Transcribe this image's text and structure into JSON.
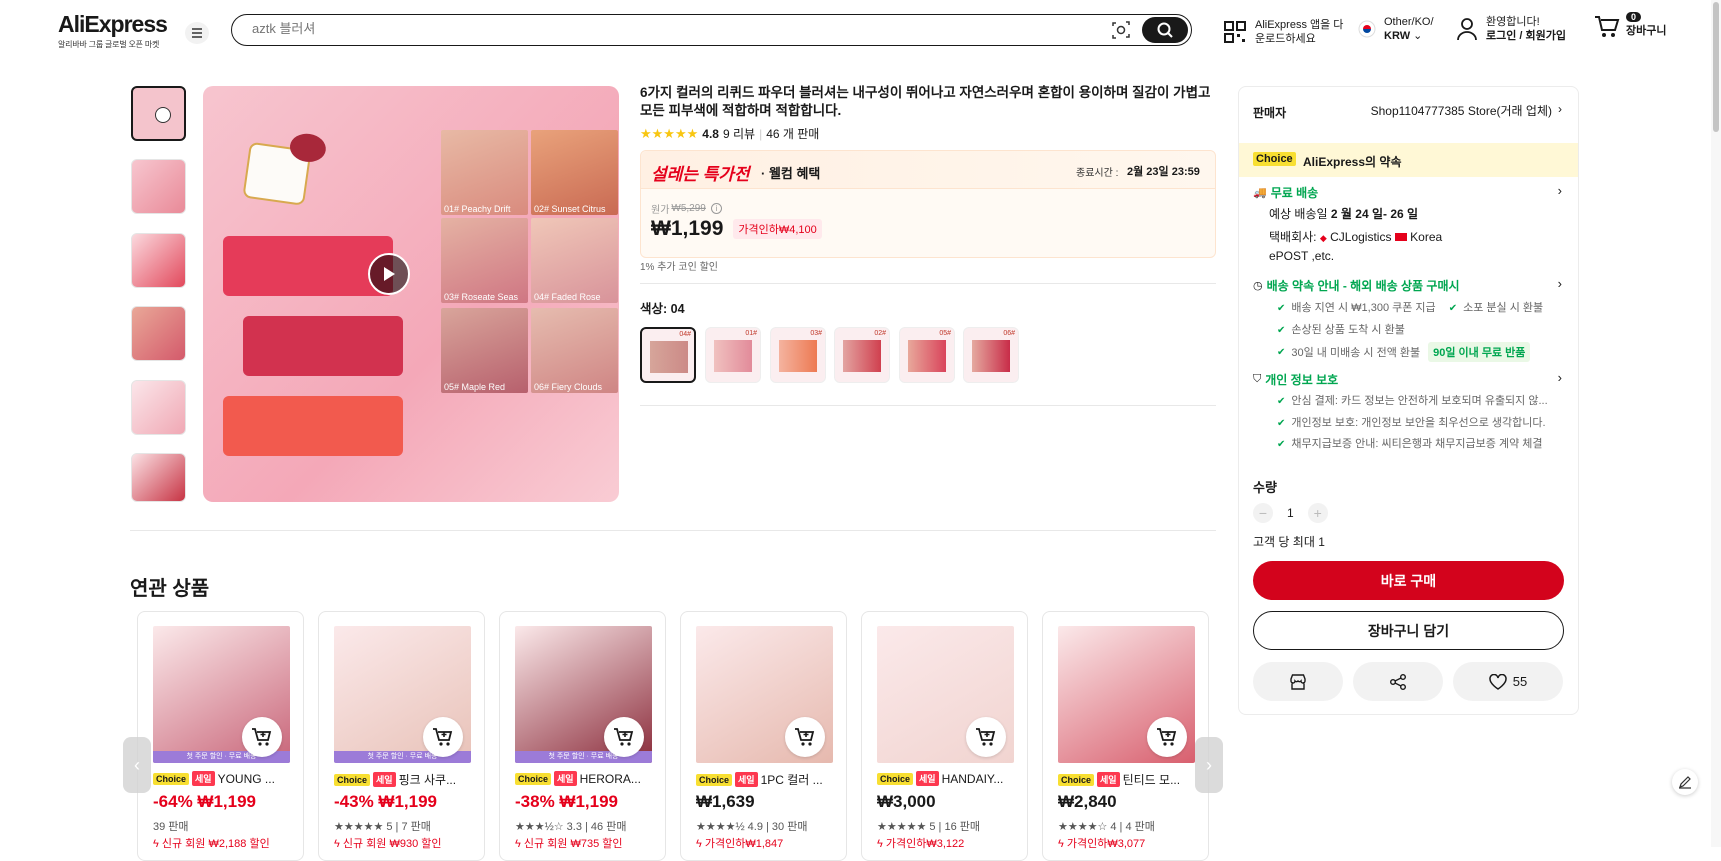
{
  "header": {
    "brand": "AliExpress",
    "tagline": "알리바바 그룹 글로벌 오픈 마켓",
    "search_placeholder": "aztk 블러셔",
    "app_line1": "AliExpress 앱을 다",
    "app_line2": "운로드하세요",
    "region_line1": "Other/KO/",
    "currency": "KRW",
    "greeting": "환영합니다!",
    "login": "로그인 / 회원가입",
    "cart_count": "0",
    "cart_label": "장바구니"
  },
  "product": {
    "title": "6가지 컬러의 리퀴드 파우더 블러셔는 내구성이 뛰어나고 자연스러우며 혼합이 용이하며 질감이 가볍고 모든 피부색에 적합하며 적합합니다.",
    "rating": "4.8",
    "reviews": "9 리뷰",
    "sold": "46 개 판매",
    "image_labels": [
      "01# Peachy Drift",
      "02# Sunset Citrus",
      "03# Roseate Seas",
      "04# Faded Rose",
      "05# Maple Red",
      "06# Fiery Clouds"
    ]
  },
  "promo": {
    "banner": "설레는 특가전",
    "banner_sub": "· 웰컴 혜택",
    "end_label": "종료시간 :",
    "end_time": "2월 23일 23:59",
    "orig_label": "원가",
    "orig_price": "₩5,299",
    "price": "₩1,199",
    "discount": "가격인하₩4,100",
    "coin": "1% 추가 코인 할인"
  },
  "color": {
    "label": "색상: 04",
    "codes": [
      "04#",
      "01#",
      "03#",
      "02#",
      "05#",
      "06#"
    ]
  },
  "related": {
    "title": "연관 상품",
    "items": [
      {
        "name": "YOUNG ...",
        "price": "-64% ₩1,199",
        "red": true,
        "stats": "39 판매",
        "coupon": "신규 회원 ₩2,188 할인",
        "band": "첫 주문 할인 · 무료 배송",
        "choice": "Choice",
        "sale": "세일",
        "color": "#c86478"
      },
      {
        "name": "핑크 사쿠...",
        "price": "-43% ₩1,199",
        "red": true,
        "stats": "★★★★★ 5 | 7 판매",
        "coupon": "신규 회원 ₩930 할인",
        "band": "첫 주문 할인 · 무료 배송",
        "choice": "Choice",
        "sale": "세일",
        "color": "#e8c2b8"
      },
      {
        "name": "HERORA...",
        "price": "-38% ₩1,199",
        "red": true,
        "stats": "★★★½☆ 3.3 | 46 판매",
        "coupon": "신규 회원 ₩735 할인",
        "band": "첫 주문 할인 · 무료 배송",
        "choice": "Choice",
        "sale": "세일",
        "color": "#8a2b3a"
      },
      {
        "name": "1PC 컬러 ...",
        "price": "₩1,639",
        "red": false,
        "stats": "★★★★½ 4.9 | 30 판매",
        "coupon": "가격인하₩1,847",
        "band": "",
        "choice": "Choice",
        "sale": "세일",
        "color": "#e6b9ae"
      },
      {
        "name": "HANDAIY...",
        "price": "₩3,000",
        "red": false,
        "stats": "★★★★★ 5 | 16 판매",
        "coupon": "가격인하₩3,122",
        "band": "",
        "choice": "Choice",
        "sale": "세일",
        "color": "#f1d4d0"
      },
      {
        "name": "틴티드 모...",
        "price": "₩2,840",
        "red": false,
        "stats": "★★★★☆ 4 | 4 판매",
        "coupon": "가격인하₩3,077",
        "band": "",
        "choice": "Choice",
        "sale": "세일",
        "color": "#d85f6e"
      }
    ]
  },
  "panel": {
    "seller_label": "판매자",
    "seller": "Shop1104777385 Store(거래 업체)",
    "choice": "Choice",
    "promise": "AliExpress의 약속",
    "free_ship": "무료 배송",
    "eta_label": "예상 배송일",
    "eta": "2 월 24 일- 26 일",
    "carrier_label": "택배회사:",
    "carrier1": "CJLogistics",
    "carrier2": "Korea",
    "carrier3": "ePOST ,etc.",
    "ship_promise": "배송 약속 안내 - 해외 배송 상품 구매시",
    "sp1": "배송 지연 시 ₩1,300 쿠폰 지급",
    "sp2": "소포 분실 시 환불",
    "sp3": "손상된 상품 도착 시 환불",
    "sp4": "30일 내 미배송 시 전액 환불",
    "sp4_badge": "90일 이내 무료 반품",
    "privacy": "개인 정보 보호",
    "pv1": "안심 결제: 카드 정보는 안전하게 보호되며 유출되지 않...",
    "pv2": "개인정보 보호: 개인정보 보안을 최우선으로 생각합니다.",
    "pv3": "채무지급보증 안내: 씨티은행과 채무지급보증 계약 체결",
    "qty_label": "수량",
    "qty": "1",
    "limit": "고객 당 최대 1",
    "buy": "바로 구매",
    "add_cart": "장바구니 담기",
    "wish_count": "55"
  }
}
